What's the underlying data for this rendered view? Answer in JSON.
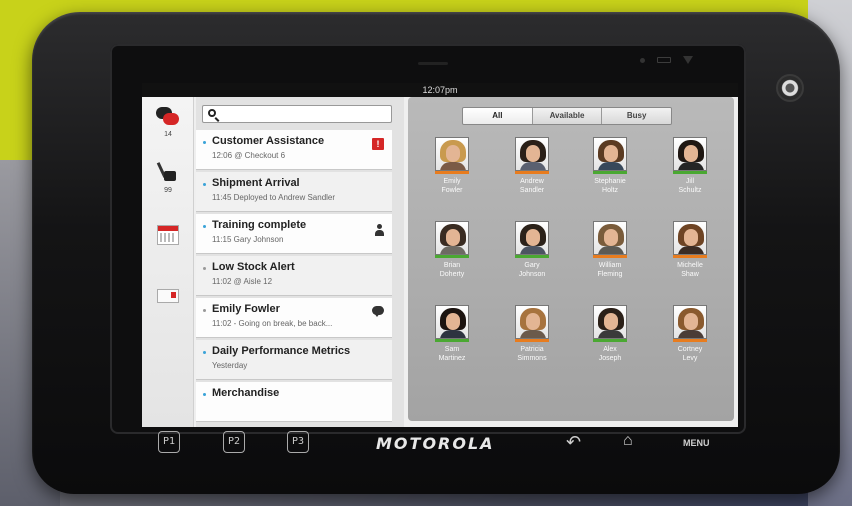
{
  "statusbar": {
    "time": "12:07pm"
  },
  "rail": [
    {
      "icon": "chat-icon",
      "count": "14"
    },
    {
      "icon": "broom-tag-icon",
      "count": "99"
    },
    {
      "icon": "calendar-icon",
      "count": ""
    },
    {
      "icon": "mail-icon",
      "count": ""
    }
  ],
  "search": {
    "placeholder": ""
  },
  "messages": [
    {
      "title": "Customer Assistance",
      "sub": "12:06  @ Checkout 6",
      "indicator": "alert-badge",
      "badge_text": "!"
    },
    {
      "title": "Shipment Arrival",
      "sub": "11:45 Deployed to Andrew Sandler",
      "indicator": ""
    },
    {
      "title": "Training complete",
      "sub": "11:15 Gary Johnson",
      "indicator": "person-icon"
    },
    {
      "title": "Low Stock Alert",
      "sub": "11:02  @ Aisle 12",
      "indicator": ""
    },
    {
      "title": "Emily  Fowler",
      "sub": "11:02 - Going on break, be back...",
      "indicator": "chat-bubble-icon"
    },
    {
      "title": "Daily Performance Metrics",
      "sub": "Yesterday",
      "indicator": ""
    },
    {
      "title": "Merchandise",
      "sub": "",
      "indicator": ""
    }
  ],
  "filter_tabs": [
    {
      "label": "All",
      "active": true
    },
    {
      "label": "Available",
      "active": false
    },
    {
      "label": "Busy",
      "active": false
    }
  ],
  "contacts": [
    {
      "first": "Emily",
      "last": "Fowler",
      "status_color": "#e87c1e",
      "hair": "#c99a4e",
      "shirt": "#7a5a46"
    },
    {
      "first": "Andrew",
      "last": "Sandler",
      "status_color": "#e87c1e",
      "hair": "#2b2018",
      "shirt": "#5a6070"
    },
    {
      "first": "Stephanie",
      "last": "Holtz",
      "status_color": "#4aa832",
      "hair": "#5b3b22",
      "shirt": "#38485a"
    },
    {
      "first": "Jill",
      "last": "Schultz",
      "status_color": "#4aa832",
      "hair": "#1f1712",
      "shirt": "#252525"
    },
    {
      "first": "Brian",
      "last": "Doherty",
      "status_color": "#4aa832",
      "hair": "#3a2c22",
      "shirt": "#6d6a63"
    },
    {
      "first": "Gary",
      "last": "Johnson",
      "status_color": "#4aa832",
      "hair": "#2c221a",
      "shirt": "#4c5462"
    },
    {
      "first": "William",
      "last": "Fleming",
      "status_color": "#e87c1e",
      "hair": "#7a5c3b",
      "shirt": "#5c5a54"
    },
    {
      "first": "Michelle",
      "last": "Shaw",
      "status_color": "#e87c1e",
      "hair": "#6e4424",
      "shirt": "#3b2c24"
    },
    {
      "first": "Sam",
      "last": "Martinez",
      "status_color": "#4aa832",
      "hair": "#1c1410",
      "shirt": "#2e3440"
    },
    {
      "first": "Patricia",
      "last": "Simmons",
      "status_color": "#e87c1e",
      "hair": "#a7733e",
      "shirt": "#6b5a4b"
    },
    {
      "first": "Alex",
      "last": "Joseph",
      "status_color": "#4aa832",
      "hair": "#2b2018",
      "shirt": "#3a3a3a"
    },
    {
      "first": "Cortney",
      "last": "Levy",
      "status_color": "#e87c1e",
      "hair": "#8a5a2e",
      "shirt": "#4b3c36"
    }
  ],
  "bezel": {
    "buttons": [
      "P1",
      "P2",
      "P3"
    ],
    "brand": "MOTOROLA",
    "back": "↶",
    "home": "⌂",
    "menu": "MENU"
  },
  "colors": {
    "accent": "#d52626",
    "available": "#4aa832",
    "busy": "#e87c1e",
    "link": "#3aa3d8"
  }
}
